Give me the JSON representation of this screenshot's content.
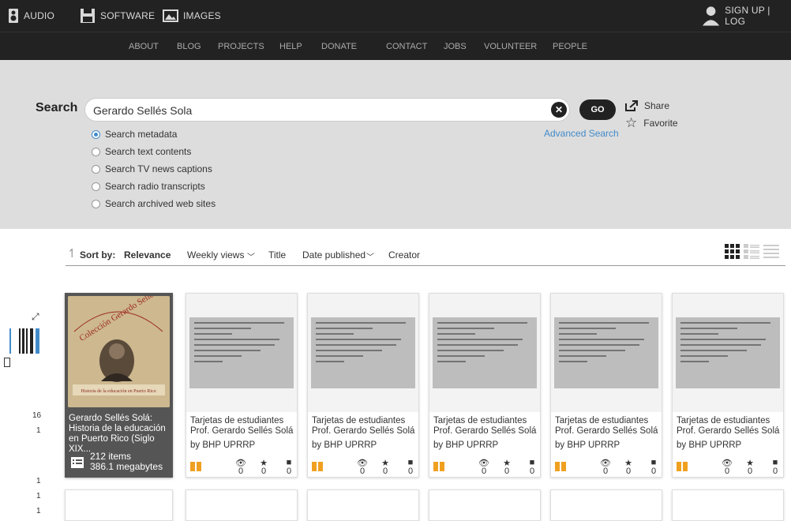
{
  "topnav": {
    "items": [
      {
        "label": "AUDIO",
        "icon": "speaker-icon"
      },
      {
        "label": "SOFTWARE",
        "icon": "floppy-icon"
      },
      {
        "label": "IMAGES",
        "icon": "image-icon"
      }
    ],
    "account": "SIGN UP | LOG"
  },
  "subnav": [
    "ABOUT",
    "BLOG",
    "PROJECTS",
    "HELP",
    "DONATE",
    "CONTACT",
    "JOBS",
    "VOLUNTEER",
    "PEOPLE"
  ],
  "search": {
    "label": "Search",
    "value": "Gerardo Sellés Sola",
    "go": "GO",
    "advanced": "Advanced Search",
    "share": "Share",
    "favorite": "Favorite",
    "options": [
      {
        "label": "Search metadata",
        "selected": true
      },
      {
        "label": "Search text contents",
        "selected": false
      },
      {
        "label": "Search TV news captions",
        "selected": false
      },
      {
        "label": "Search radio transcripts",
        "selected": false
      },
      {
        "label": "Search archived web sites",
        "selected": false
      }
    ]
  },
  "sort": {
    "label": "Sort by:",
    "options": [
      "Relevance",
      "Weekly views",
      "Title",
      "Date published",
      "Creator"
    ]
  },
  "collection": {
    "cover_text": [
      "Colección Gerardo Sellés Solá",
      "Historia de la educación en Puerto Rico"
    ],
    "title": "Gerardo Sellés Solá: Historia de la educación en Puerto Rico (Siglo XIX...",
    "items": "212 items",
    "size": "386.1 megabytes"
  },
  "sidebar": {
    "numbers": [
      "16",
      "1",
      "1",
      "1",
      "1"
    ]
  },
  "cards": [
    {
      "title": "Tarjetas de estudiantes Prof. Gerardo Sellés Solá",
      "by": "by BHP UPRRP",
      "views": "0",
      "favs": "0",
      "reviews": "0"
    },
    {
      "title": "Tarjetas de estudiantes Prof. Gerardo Sellés Solá",
      "by": "by BHP UPRRP",
      "views": "0",
      "favs": "0",
      "reviews": "0"
    },
    {
      "title": "Tarjetas de estudiantes Prof. Gerardo Sellés Solá",
      "by": "by BHP UPRRP",
      "views": "0",
      "favs": "0",
      "reviews": "0"
    },
    {
      "title": "Tarjetas de estudiantes Prof. Gerardo Sellés Solá",
      "by": "by BHP UPRRP",
      "views": "0",
      "favs": "0",
      "reviews": "0"
    },
    {
      "title": "Tarjetas de estudiantes Prof. Gerardo Sellés Solá",
      "by": "by BHP UPRRP",
      "views": "0",
      "favs": "0",
      "reviews": "0"
    }
  ],
  "colors": {
    "accent": "#428bca",
    "donate_dot": "#ff0033",
    "bar": "#222222"
  }
}
